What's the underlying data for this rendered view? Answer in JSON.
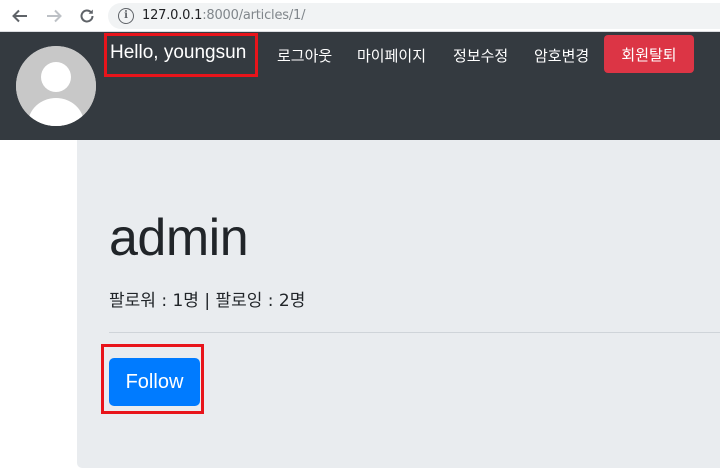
{
  "browser": {
    "url_host": "127.0.0.1",
    "url_rest": ":8000/articles/1/",
    "back_icon": "back-arrow-icon",
    "forward_icon": "forward-arrow-icon",
    "reload_icon": "reload-icon",
    "info_icon": "info-icon",
    "info_glyph": "i"
  },
  "navbar": {
    "greeting": "Hello, youngsun",
    "links": [
      {
        "label": "로그아웃"
      },
      {
        "label": "마이페이지"
      },
      {
        "label": "정보수정"
      },
      {
        "label": "암호변경"
      }
    ],
    "delete_button": "회원탈퇴",
    "avatar_icon": "user-avatar-icon",
    "colors": {
      "background": "#343a40",
      "danger": "#dc3545"
    }
  },
  "profile": {
    "username": "admin",
    "follow_stats": "팔로워 : 1명 | 팔로잉 : 2명",
    "follow_button": "Follow",
    "colors": {
      "primary": "#007bff",
      "highlight": "#e8141b"
    }
  }
}
